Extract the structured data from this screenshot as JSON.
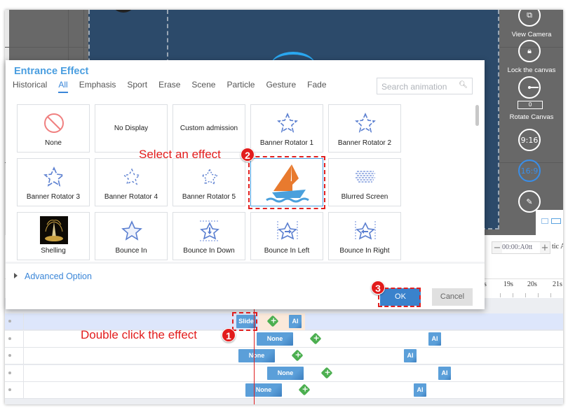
{
  "canvas_tools": [
    {
      "name": "view-camera",
      "label": "View Camera"
    },
    {
      "name": "lock-canvas",
      "label": "Lock the canvas"
    },
    {
      "name": "rotate-canvas",
      "label": "Rotate Canvas",
      "value": "0"
    },
    {
      "name": "ratio-9-16",
      "label": "9:16"
    },
    {
      "name": "ratio-16-9",
      "label": "16:9",
      "active": true
    }
  ],
  "dialog": {
    "title": "Entrance Effect",
    "tabs": [
      "Historical",
      "All",
      "Emphasis",
      "Sport",
      "Erase",
      "Scene",
      "Particle",
      "Gesture",
      "Fade"
    ],
    "active_tab": "All",
    "search_placeholder": "Search animation",
    "effects": [
      {
        "label": "None",
        "icon": "no-entry-icon"
      },
      {
        "label": "No Display",
        "icon": ""
      },
      {
        "label": "Custom admission",
        "icon": ""
      },
      {
        "label": "Banner Rotator 1",
        "icon": "star-icon"
      },
      {
        "label": "Banner Rotator 2",
        "icon": "star-icon"
      },
      {
        "label": "Banner Rotator 3",
        "icon": "star-icon"
      },
      {
        "label": "Banner Rotator 4",
        "icon": "star-icon"
      },
      {
        "label": "Banner Rotator 5",
        "icon": "star-icon"
      },
      {
        "label": "",
        "icon": "sailboat-icon",
        "selected": true
      },
      {
        "label": "Blurred Screen",
        "icon": "blurred-screen-icon"
      },
      {
        "label": "Shelling",
        "icon": "fountain-image"
      },
      {
        "label": "Bounce In",
        "icon": "star-icon"
      },
      {
        "label": "Bounce In Down",
        "icon": "star-down-icon"
      },
      {
        "label": "Bounce In Left",
        "icon": "star-right-arrow-icon"
      },
      {
        "label": "Bounce In Right",
        "icon": "star-left-arrow-icon"
      }
    ],
    "advanced_option": "Advanced Option",
    "ok_label": "OK",
    "cancel_label": "Cancel"
  },
  "timeline": {
    "time_value": "00:00:A0tt",
    "minus": "−",
    "plus": "+",
    "side_label": "tic A",
    "ruler_ticks": [
      "s",
      "19s",
      "20s",
      "21s"
    ],
    "rows": [
      {
        "clips": [
          {
            "label": "Slide"
          },
          {
            "label": "AI"
          }
        ],
        "active": true
      },
      {
        "clips": [
          {
            "label": "None"
          },
          {
            "label": "AI"
          }
        ]
      },
      {
        "clips": [
          {
            "label": "None"
          },
          {
            "label": "AI"
          }
        ]
      },
      {
        "clips": [
          {
            "label": "None"
          },
          {
            "label": "AI"
          }
        ]
      },
      {
        "clips": [
          {
            "label": "None"
          },
          {
            "label": "AI"
          }
        ]
      }
    ]
  },
  "annotations": {
    "step1": {
      "num": "1",
      "text": "Double click the effect"
    },
    "step2": {
      "num": "2",
      "text": "Select an effect"
    },
    "step3": {
      "num": "3",
      "text": ""
    }
  },
  "colors": {
    "accent": "#3a86d8",
    "stage": "#2c4a6a",
    "annotation": "#e21c1c",
    "ok_button": "#3a82cc"
  }
}
